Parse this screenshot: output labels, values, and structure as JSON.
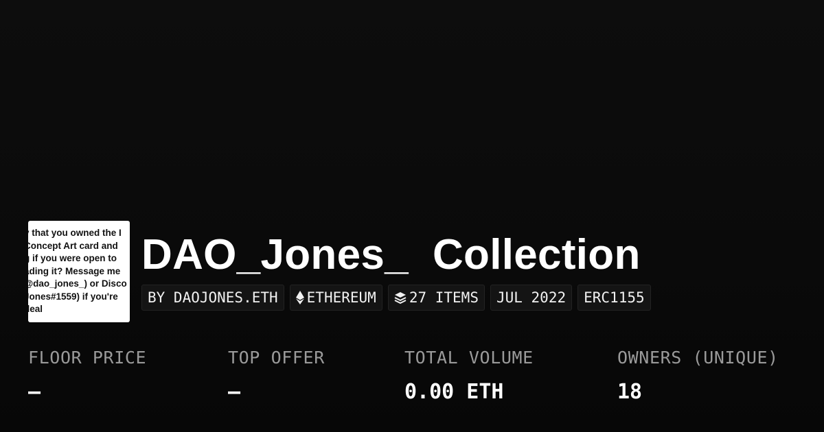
{
  "collection": {
    "title": "DAO_Jones_  Collection",
    "thumbnail_text": [
      "y that you owned the I",
      "Concept Art card and",
      "g if you were open to",
      "ading it? Message me",
      "@dao_jones_) or Disco",
      "Jones#1559) if you're",
      " deal"
    ]
  },
  "tags": {
    "creator": "BY DAOJONES.ETH",
    "chain": "ETHEREUM",
    "chain_icon": "ethereum-icon",
    "items": "27 ITEMS",
    "items_icon": "layers-icon",
    "date": "JUL 2022",
    "standard": "ERC1155"
  },
  "stats": {
    "floor_price": {
      "label": "FLOOR PRICE",
      "value": "–"
    },
    "top_offer": {
      "label": "TOP OFFER",
      "value": "–"
    },
    "total_volume": {
      "label": "TOTAL VOLUME",
      "value": "0.00 ETH"
    },
    "owners": {
      "label": "OWNERS (UNIQUE)",
      "value": "18"
    }
  },
  "colors": {
    "background": "#0b0b0b",
    "tag_background": "#141414",
    "label": "#9a9a9a",
    "text": "#ffffff"
  }
}
